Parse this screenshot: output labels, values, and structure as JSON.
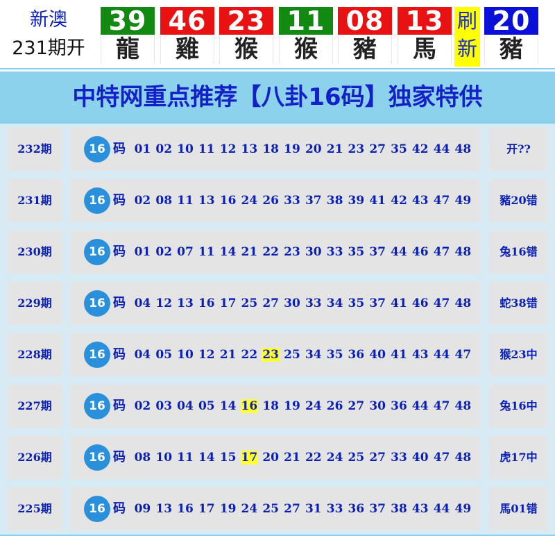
{
  "top": {
    "issue_line1": "新澳",
    "issue_line2": "231期开",
    "balls": [
      {
        "num": "39",
        "zodiac": "龍",
        "color": "#128a12"
      },
      {
        "num": "46",
        "zodiac": "雞",
        "color": "#e81212"
      },
      {
        "num": "23",
        "zodiac": "猴",
        "color": "#e81212"
      },
      {
        "num": "11",
        "zodiac": "猴",
        "color": "#128a12"
      },
      {
        "num": "08",
        "zodiac": "豬",
        "color": "#e81212"
      },
      {
        "num": "13",
        "zodiac": "馬",
        "color": "#e81212"
      },
      {
        "num": "20",
        "zodiac": "豬",
        "color": "#0a10d8"
      }
    ],
    "refresh_line1": "刷",
    "refresh_line2": "新"
  },
  "banner": {
    "title": "中特网重点推荐【八卦16码】独家特供"
  },
  "rows": [
    {
      "period": "232期",
      "badge": "16",
      "ma": "码",
      "numbers": [
        "01",
        "02",
        "10",
        "11",
        "12",
        "13",
        "18",
        "19",
        "20",
        "21",
        "23",
        "27",
        "35",
        "42",
        "44",
        "48"
      ],
      "highlight": "",
      "result": "开??"
    },
    {
      "period": "231期",
      "badge": "16",
      "ma": "码",
      "numbers": [
        "02",
        "08",
        "11",
        "13",
        "16",
        "24",
        "26",
        "33",
        "37",
        "38",
        "39",
        "41",
        "42",
        "43",
        "47",
        "49"
      ],
      "highlight": "",
      "result": "豬20错"
    },
    {
      "period": "230期",
      "badge": "16",
      "ma": "码",
      "numbers": [
        "01",
        "02",
        "07",
        "11",
        "14",
        "21",
        "22",
        "23",
        "30",
        "33",
        "35",
        "37",
        "44",
        "46",
        "47",
        "48"
      ],
      "highlight": "",
      "result": "兔16错"
    },
    {
      "period": "229期",
      "badge": "16",
      "ma": "码",
      "numbers": [
        "04",
        "12",
        "13",
        "16",
        "17",
        "25",
        "27",
        "30",
        "33",
        "34",
        "35",
        "37",
        "41",
        "46",
        "47",
        "48"
      ],
      "highlight": "",
      "result": "蛇38错"
    },
    {
      "period": "228期",
      "badge": "16",
      "ma": "码",
      "numbers": [
        "04",
        "05",
        "10",
        "12",
        "21",
        "22",
        "23",
        "25",
        "34",
        "35",
        "36",
        "40",
        "41",
        "43",
        "44",
        "47"
      ],
      "highlight": "23",
      "result": "猴23中"
    },
    {
      "period": "227期",
      "badge": "16",
      "ma": "码",
      "numbers": [
        "02",
        "03",
        "04",
        "05",
        "14",
        "16",
        "18",
        "19",
        "24",
        "26",
        "27",
        "30",
        "36",
        "44",
        "47",
        "48"
      ],
      "highlight": "16",
      "result": "兔16中"
    },
    {
      "period": "226期",
      "badge": "16",
      "ma": "码",
      "numbers": [
        "08",
        "10",
        "11",
        "14",
        "15",
        "17",
        "20",
        "21",
        "22",
        "24",
        "25",
        "27",
        "33",
        "40",
        "47",
        "48"
      ],
      "highlight": "17",
      "result": "虎17中"
    },
    {
      "period": "225期",
      "badge": "16",
      "ma": "码",
      "numbers": [
        "09",
        "13",
        "16",
        "17",
        "19",
        "24",
        "25",
        "27",
        "31",
        "33",
        "36",
        "37",
        "38",
        "43",
        "44",
        "49"
      ],
      "highlight": "",
      "result": "馬01错"
    }
  ]
}
